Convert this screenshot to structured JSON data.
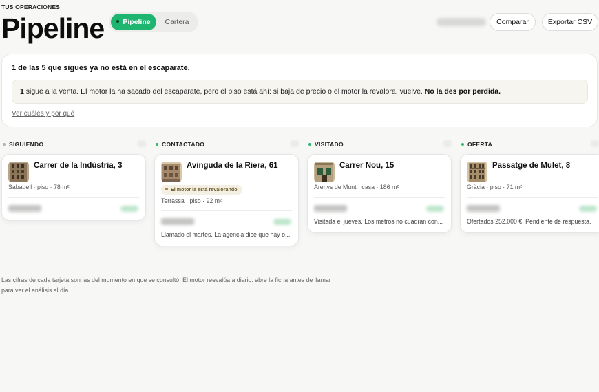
{
  "header": {
    "eyebrow": "TUS OPERACIONES",
    "title": "Pipeline",
    "tabs": [
      {
        "label": "Pipeline",
        "active": true
      },
      {
        "label": "Cartera",
        "active": false
      }
    ],
    "compare_label": "Comparar",
    "export_label": "Exportar CSV"
  },
  "notice": {
    "title": "1 de las 5 que sigues ya no está en el escaparate.",
    "body_count": "1",
    "body_text": " sigue a la venta. El motor la ha sacado del escaparate, pero el piso está ahí: si baja de precio o el motor la revalora, vuelve. ",
    "body_emphasis": "No la des por perdida.",
    "link": "Ver cuáles y por qué"
  },
  "columns": [
    {
      "title": "SIGUIENDO",
      "dot_color": "#b0b0ae",
      "card": {
        "address": "Carrer de la Indústria, 3",
        "meta": "Sabadell · piso · 78 m²",
        "chip": null,
        "note": null
      }
    },
    {
      "title": "CONTACTADO",
      "dot_color": "#2fb86e",
      "card": {
        "address": "Avinguda de la Riera, 61",
        "meta": "Terrassa · piso · 92 m²",
        "chip": "El motor la está revalorando",
        "note": "Llamado el martes. La agencia dice que hay o..."
      }
    },
    {
      "title": "VISITADO",
      "dot_color": "#2fb86e",
      "card": {
        "address": "Carrer Nou, 15",
        "meta": "Arenys de Munt · casa · 186 m²",
        "chip": null,
        "note": "Visitada el jueves. Los metros no cuadran con..."
      }
    },
    {
      "title": "OFERTA",
      "dot_color": "#2fb86e",
      "card": {
        "address": "Passatge de Mulet, 8",
        "meta": "Gràcia · piso · 71 m²",
        "chip": null,
        "note": "Ofertados 252.000 €. Pendiente de respuesta."
      }
    }
  ],
  "footer": {
    "text": "Las cifras de cada tarjeta son las del momento en que se consultó. El motor reevalúa a diario: abre la ficha antes de llamar para ver el análisis al día."
  }
}
